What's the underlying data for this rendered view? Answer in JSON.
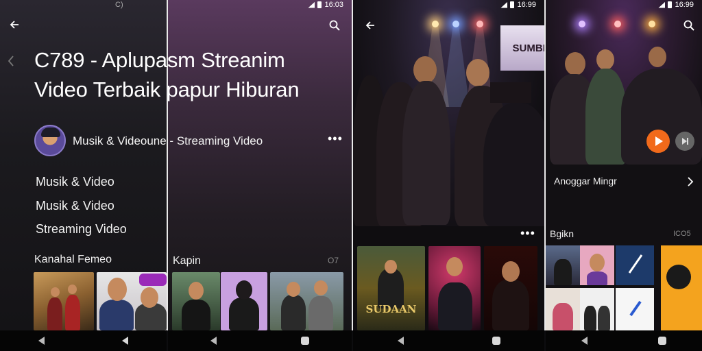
{
  "panel1": {
    "status_partial": "C)",
    "title_line1": "C789 - Aplupasm Streanim",
    "title_line2": "Video Terbaik papur Hiburan",
    "channel_name": "Musik & Videoune - Streaming Video",
    "categories": [
      "Musik & Video",
      "Musik & Video",
      "Streaming Video"
    ],
    "section_title": "Kanahal Femeo",
    "icons": {
      "back": "arrow-left-icon",
      "side": "chevron-left-icon"
    }
  },
  "panel2": {
    "status_time": "16:03",
    "section_title": "Kapin",
    "section_count": "O7",
    "icons": {
      "search": "search-icon",
      "more": "more-dots-icon"
    }
  },
  "panel3": {
    "status_time": "16:99",
    "screen_text": "SUMBER",
    "poster_text": "SUDAAN",
    "icons": {
      "back": "arrow-left-icon",
      "more": "more-dots-icon"
    }
  },
  "panel4": {
    "status_time": "16:99",
    "now_playing": "Anoggar Mingr",
    "section_title": "Bgikn",
    "section_count": "ICO5",
    "accent_color": "#f26a1b",
    "icons": {
      "search": "search-icon",
      "play": "play-icon",
      "next": "chevron-right-icon"
    }
  }
}
